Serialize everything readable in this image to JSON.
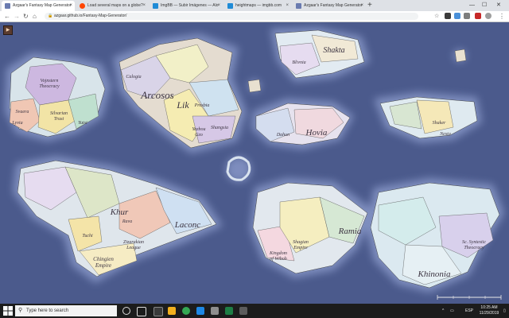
{
  "browser": {
    "tabs": [
      {
        "label": "Azgaar's Fantasy Map Generator",
        "favicon_color": "#6a7bb0",
        "active": true
      },
      {
        "label": "Load several maps on a globe?",
        "favicon_color": "#ff4500",
        "active": false
      },
      {
        "label": "ImgBB — Subir Imágenes — Alo",
        "favicon_color": "#1f8bd6",
        "active": false
      },
      {
        "label": "heightmaps — imgbb.com",
        "favicon_color": "#1f8bd6",
        "active": false
      },
      {
        "label": "Azgaar's Fantasy Map Generator",
        "favicon_color": "#6a7bb0",
        "active": false
      }
    ],
    "new_tab": "+",
    "url": "azgaar.github.io/Fantasy-Map-Generator/"
  },
  "map": {
    "ocean_color": "#4b5a8c",
    "labels": [
      {
        "text": "Vojnstern Theocracy",
        "lines": [
          "Vojnstern",
          "Theocracy"
        ],
        "size": "small"
      },
      {
        "text": "Svaera",
        "lines": [
          "Svaera"
        ],
        "size": "small"
      },
      {
        "text": "Lyvia",
        "lines": [
          "Lyvia"
        ],
        "size": "small"
      },
      {
        "text": "Silvarian Trust",
        "lines": [
          "Silvarian",
          "Trust"
        ],
        "size": "small"
      },
      {
        "text": "Yutsi",
        "lines": [
          "Yutsi"
        ],
        "size": "small"
      },
      {
        "text": "Calogia",
        "lines": [
          "Calogia"
        ],
        "size": "small"
      },
      {
        "text": "Arcosos",
        "lines": [
          "Arcosos"
        ],
        "size": "large"
      },
      {
        "text": "Lik",
        "lines": [
          "Lik"
        ],
        "size": "large"
      },
      {
        "text": "Prosbia",
        "lines": [
          "Prosbia"
        ],
        "size": "small"
      },
      {
        "text": "Yazhou Gzo",
        "lines": [
          "Yazhou",
          "Gzo"
        ],
        "size": "small"
      },
      {
        "text": "Shangsia",
        "lines": [
          "Shangsia"
        ],
        "size": "small"
      },
      {
        "text": "Shakta",
        "lines": [
          "Shakta"
        ],
        "size": "large"
      },
      {
        "text": "Blivnia",
        "lines": [
          "Blivnia"
        ],
        "size": "small"
      },
      {
        "text": "Dahun",
        "lines": [
          "Dahun"
        ],
        "size": "small"
      },
      {
        "text": "Hovia",
        "lines": [
          "Hovia"
        ],
        "size": "large"
      },
      {
        "text": "Shaker",
        "lines": [
          "Shaker"
        ],
        "size": "small"
      },
      {
        "text": "Nesta",
        "lines": [
          "Nesta"
        ],
        "size": "small"
      },
      {
        "text": "Khur",
        "lines": [
          "Khur"
        ],
        "size": "large"
      },
      {
        "text": "Rava",
        "lines": [
          "Rava"
        ],
        "size": "small"
      },
      {
        "text": "Laconc",
        "lines": [
          "Laconc"
        ],
        "size": "large"
      },
      {
        "text": "Tuchi",
        "lines": [
          "Tuchi"
        ],
        "size": "small"
      },
      {
        "text": "Zizarakian League",
        "lines": [
          "Zizarakian",
          "League"
        ],
        "size": "small"
      },
      {
        "text": "Chingien Empire",
        "lines": [
          "Chingien",
          "Empire"
        ],
        "size": "medium"
      },
      {
        "text": "Kingdom of Wiboh",
        "lines": [
          "Kingdom",
          "of Wiboh"
        ],
        "size": "small"
      },
      {
        "text": "Shagian Empire",
        "lines": [
          "Shagian",
          "Empire"
        ],
        "size": "small"
      },
      {
        "text": "Ramia",
        "lines": [
          "Ramia"
        ],
        "size": "large"
      },
      {
        "text": "Sc. Syntestic Theocracy",
        "lines": [
          "Sc. Syntestic",
          "Theocracy"
        ],
        "size": "small"
      },
      {
        "text": "Khinonia",
        "lines": [
          "Khinonia"
        ],
        "size": "large"
      }
    ]
  },
  "taskbar": {
    "search_placeholder": "Type here to search",
    "language": "ESP",
    "time": "10:25 AM",
    "date": "11/29/2019"
  }
}
